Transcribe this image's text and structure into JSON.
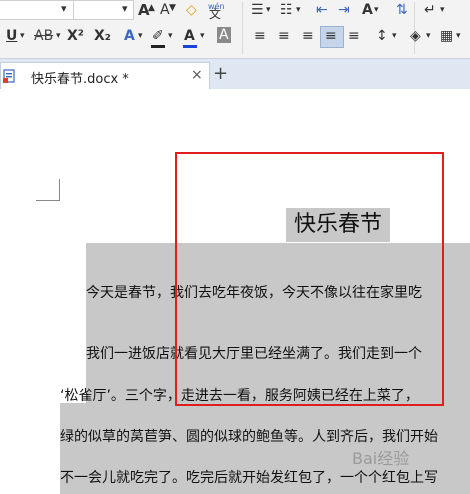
{
  "ribbon": {
    "row1": {
      "dropdown1": "▾",
      "dropdown2": "▾",
      "grow_font": "A",
      "shrink_font": "A",
      "clear_format": "◇",
      "phonetic_guide_top": "wén",
      "phonetic_guide_bottom": "文",
      "bullets": "☰",
      "numbering": "☷",
      "decrease_indent": "⇤",
      "increase_indent": "⇥",
      "char_shading": "A",
      "sort": "⇅",
      "paragraph_mark": "↵"
    },
    "row2": {
      "underline": "U",
      "strikethrough": "AB",
      "superscript": "X²",
      "subscript": "X₂",
      "text_effect": "A",
      "highlight": "✐",
      "font_color": "A",
      "char_border": "A",
      "align_left": "≡",
      "align_center": "≡",
      "align_right": "≡",
      "justify": "≡",
      "distributed": "≡",
      "line_spacing": "↕",
      "fill": "◈",
      "borders": "▦"
    }
  },
  "tab": {
    "title": "快乐春节.docx *",
    "close": "×",
    "add": "+"
  },
  "document": {
    "title": "快乐春节",
    "lines": [
      "今天是春节，我们去吃年夜饭，今天不像以往在家里吃",
      "我们一进饭店就看见大厅里已经坐满了。我们走到一个",
      "‘松雀厅’。三个字，走进去一看，服务阿姨已经在上菜了，",
      "绿的似草的莴苣笋、圆的似球的鲍鱼等。人到齐后，我们开始",
      "不一会儿就吃完了。吃完后就开始发红包了，一个个红包上写"
    ]
  },
  "watermark": "Bai经验"
}
